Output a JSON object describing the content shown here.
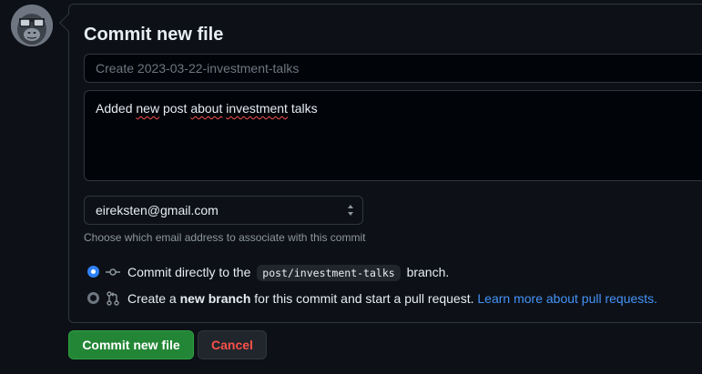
{
  "commit_form": {
    "title": "Commit new file",
    "summary_placeholder": "Create 2023-03-22-investment-talks",
    "description_words": [
      "Added",
      "new",
      "post",
      "about",
      "investment",
      "talks"
    ],
    "email": {
      "selected": "eireksten@gmail.com",
      "hint": "Choose which email address to associate with this commit"
    },
    "options": {
      "direct": {
        "text_before": "Commit directly to the",
        "branch": "post/investment-talks",
        "text_after": "branch.",
        "selected": true
      },
      "new_branch": {
        "text_before": "Create a",
        "bold": "new branch",
        "text_after": "for this commit and start a pull request.",
        "link": "Learn more about pull requests.",
        "selected": false
      }
    }
  },
  "buttons": {
    "commit": "Commit new file",
    "cancel": "Cancel"
  },
  "colors": {
    "background": "#0d1117",
    "border": "#30363d",
    "primary_button": "#238636",
    "danger_text": "#f85149",
    "link": "#4493f8",
    "radio_selected": "#2f81f7"
  },
  "icons": {
    "avatar": "gorilla-avatar",
    "direct_commit": "git-commit-icon",
    "new_branch": "git-pull-request-icon",
    "select": "select-arrows-icon"
  }
}
